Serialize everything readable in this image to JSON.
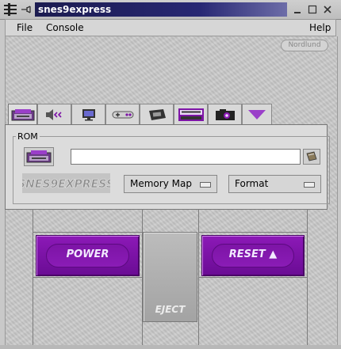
{
  "window": {
    "title": "snes9express"
  },
  "menubar": {
    "items": [
      "File",
      "Console",
      "Help"
    ]
  },
  "branding": {
    "badge": "Nordlund"
  },
  "tabs": [
    {
      "name": "rom-tab",
      "icon": "cartridge-icon",
      "active": true
    },
    {
      "name": "sound-tab",
      "icon": "speaker-icon"
    },
    {
      "name": "video-tab",
      "icon": "monitor-icon"
    },
    {
      "name": "controller-tab",
      "icon": "gamepad-icon"
    },
    {
      "name": "peripheral-tab",
      "icon": "chip-icon"
    },
    {
      "name": "netplay-tab",
      "icon": "netplay-icon"
    },
    {
      "name": "snapshot-tab",
      "icon": "camera-icon"
    },
    {
      "name": "more-tab",
      "icon": "down-triangle-icon"
    }
  ],
  "rom_panel": {
    "legend": "ROM",
    "rom_path": "",
    "logo_text": "SNES9EXPRESS",
    "memory_map_label": "Memory Map",
    "format_label": "Format"
  },
  "console": {
    "power_label": "POWER",
    "reset_label": "RESET",
    "eject_label": "EJECT"
  },
  "colors": {
    "title_bar": "#272773",
    "console_button": "#7d14a6",
    "tab_accent": "#9a3fc9"
  }
}
